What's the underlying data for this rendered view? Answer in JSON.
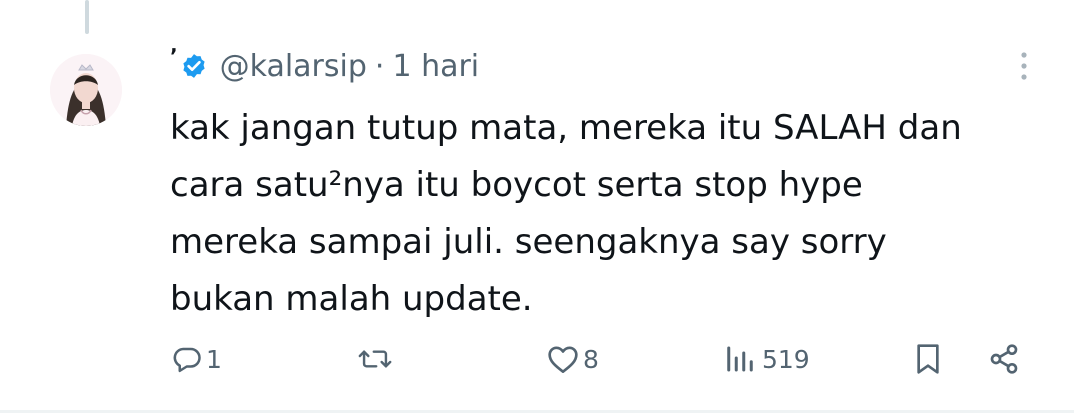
{
  "tweet": {
    "display_name": "ʼ",
    "handle": "@kalarsip",
    "separator": "·",
    "time": "1 hari",
    "text": "kak jangan tutup mata, mereka itu SALAH dan\ncara satu²nya itu boycot serta stop hype\nmereka sampai juli. seengaknya say sorry\nbukan malah update."
  },
  "actions": {
    "reply_count": "1",
    "retweet_count": "",
    "like_count": "8",
    "view_count": "519"
  },
  "icons": {
    "verified": "verified-badge-icon",
    "more": "more-vertical-icon",
    "reply": "reply-icon",
    "retweet": "retweet-icon",
    "like": "heart-icon",
    "views": "views-icon",
    "bookmark": "bookmark-icon",
    "share": "share-icon"
  },
  "colors": {
    "verified": "#1d9bf0",
    "text": "#0f1419",
    "muted": "#536471",
    "divider": "#eff3f4"
  }
}
